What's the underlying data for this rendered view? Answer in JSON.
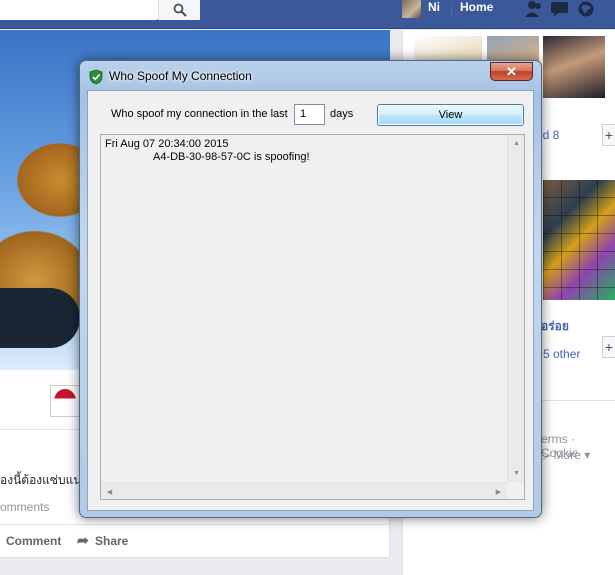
{
  "facebook": {
    "topbar": {
      "user_name": "Ni",
      "home_label": "Home",
      "icons": [
        "search-icon",
        "friend-requests-icon",
        "messages-icon",
        "notifications-icon"
      ]
    },
    "feed": {
      "post_text": "องนี้ต้องแซ่บแน่ๆ",
      "comments_text": "omments",
      "comment_label": "Comment",
      "share_label": "Share"
    },
    "sidebar": {
      "friends_text": "nd 8",
      "page_name_text": "อร่อย",
      "other_text": "5 other",
      "add_label": "+",
      "terms_text": "erms · Cookie",
      "more_label": "More"
    }
  },
  "dialog": {
    "title": "Who Spoof My Connection",
    "close_label": "✕",
    "label_last": "Who spoof my connection in the last",
    "days_value": "1",
    "label_days": "days",
    "view_button": "View",
    "log": [
      "Fri Aug 07 20:34:00 2015",
      "A4-DB-30-98-57-0C is spoofing!"
    ]
  },
  "colors": {
    "fb_blue": "#3b5998",
    "link_blue": "#4267b2",
    "dialog_frame": "#b9d1ea",
    "close_red": "#c0402b"
  }
}
